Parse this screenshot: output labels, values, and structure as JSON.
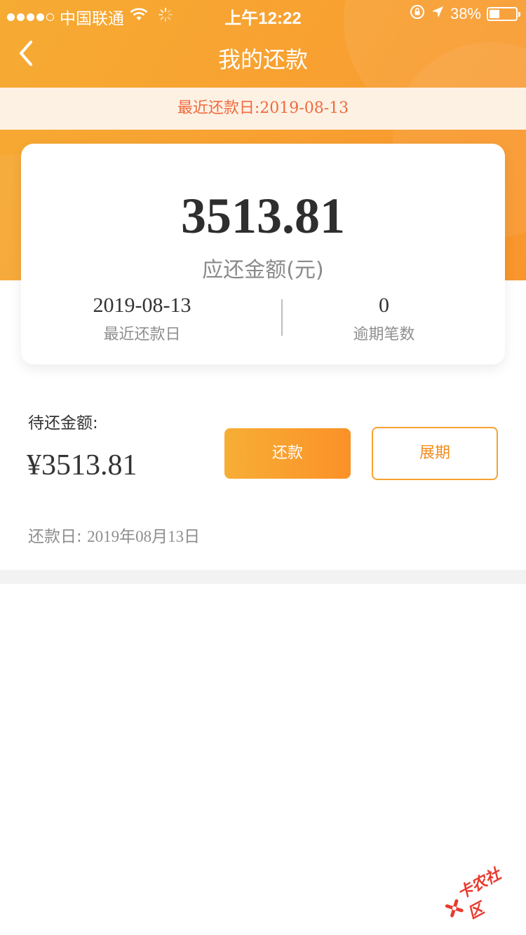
{
  "status_bar": {
    "carrier": "中国联通",
    "time": "上午12:22",
    "battery_percent": "38%",
    "battery_level": 0.38,
    "icons": [
      "signal-dots-icon",
      "wifi-icon",
      "loading-spinner-icon",
      "rotation-lock-icon",
      "location-arrow-icon",
      "battery-icon"
    ]
  },
  "nav": {
    "title": "我的还款",
    "back_icon": "chevron-left-icon"
  },
  "notice": {
    "text": "最近还款日:2019-08-13"
  },
  "summary": {
    "amount": "3513.81",
    "amount_label": "应还金额(元)",
    "next_due_value": "2019-08-13",
    "next_due_label": "最近还款日",
    "overdue_count": "0",
    "overdue_label": "逾期笔数"
  },
  "pending": {
    "label": "待还金额:",
    "value": "¥3513.81",
    "repay_button": "还款",
    "extend_button": "展期",
    "due_label": "还款日:",
    "due_value": "2019年08月13日"
  },
  "watermark": {
    "text": "卡农社区"
  },
  "colors": {
    "brand_orange": "#f8a031",
    "notice_bg": "#fdf1e4",
    "notice_text": "#f06a3c",
    "extend_border": "#f7a232"
  }
}
